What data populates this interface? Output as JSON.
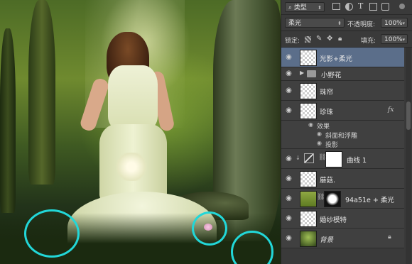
{
  "colors": {
    "annotation": "#22d7d8",
    "active_layer": "#5b6e8a",
    "panel": "#3c3c3c"
  },
  "canvas": {
    "description_icon": "forest-bride-image"
  },
  "layers_panel": {
    "filter_kind": "类型",
    "filter_icons": [
      "image-filter-icon",
      "adjustment-filter-icon",
      "type-filter-icon",
      "shape-filter-icon",
      "smart-object-filter-icon"
    ],
    "blend_mode": "柔光",
    "opacity_label": "不透明度:",
    "opacity_value": "100%",
    "lock_label": "锁定:",
    "fill_label": "填充:",
    "fill_value": "100%",
    "layers": [
      {
        "name": "光影+柔光",
        "active": true
      },
      {
        "name": "小野花",
        "type": "group"
      },
      {
        "name": "珠帘"
      },
      {
        "name": "珍珠",
        "fx": "fx",
        "effects_label": "效果",
        "effects": [
          "斜面和浮雕",
          "投影"
        ]
      },
      {
        "name": "曲线 1",
        "type": "adjustment"
      },
      {
        "name": "蘑菇."
      },
      {
        "name": "94a51e + 柔光"
      },
      {
        "name": "婚纱模特"
      },
      {
        "name": "背景",
        "locked": true
      }
    ]
  }
}
